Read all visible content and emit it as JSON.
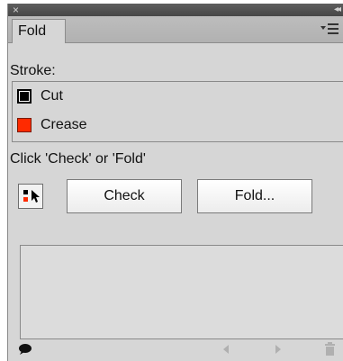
{
  "panel": {
    "tab_label": "Fold",
    "close_glyph": "×",
    "collapse_glyph": "◂◂",
    "menu_icon": "panel-menu-icon"
  },
  "stroke": {
    "label": "Stroke:",
    "items": [
      {
        "label": "Cut",
        "color": "#000000"
      },
      {
        "label": "Crease",
        "color": "#ff2a00"
      }
    ]
  },
  "hint_text": "Click 'Check' or 'Fold'",
  "buttons": {
    "check_label": "Check",
    "fold_label": "Fold..."
  },
  "footer": {
    "icons": [
      "speech-bubble-icon",
      "previous-icon",
      "next-icon",
      "trash-icon"
    ]
  }
}
